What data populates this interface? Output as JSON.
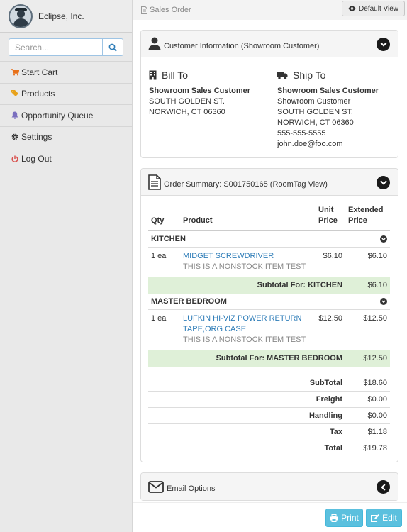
{
  "sidebar": {
    "company": "Eclipse, Inc.",
    "search_placeholder": "Search...",
    "items": [
      {
        "label": "Start Cart",
        "icon": "cart-icon",
        "color": "#e8711a"
      },
      {
        "label": "Products",
        "icon": "tags-icon",
        "color": "#e8a21a"
      },
      {
        "label": "Opportunity Queue",
        "icon": "bell-icon",
        "color": "#7a6fbf"
      },
      {
        "label": "Settings",
        "icon": "gear-icon",
        "color": "#333333"
      },
      {
        "label": "Log Out",
        "icon": "power-icon",
        "color": "#d9534f"
      }
    ]
  },
  "header": {
    "breadcrumb": "Sales Order",
    "default_view_label": "Default View"
  },
  "customer": {
    "title": "Customer Information (Showroom Customer)",
    "bill_to": {
      "heading": "Bill To",
      "name": "Showroom Sales Customer",
      "line1": "SOUTH GOLDEN ST.",
      "line2": "NORWICH, CT 06360"
    },
    "ship_to": {
      "heading": "Ship To",
      "name": "Showroom Sales Customer",
      "line1": "Showroom Customer",
      "line2": "SOUTH GOLDEN ST.",
      "line3": "NORWICH, CT 06360",
      "phone": "555-555-5555",
      "email": "john.doe@foo.com"
    }
  },
  "order": {
    "title": "Order Summary: S001750165 (RoomTag View)",
    "columns": {
      "qty": "Qty",
      "product": "Product",
      "unit_price_1": "Unit",
      "unit_price_2": "Price",
      "ext_price_1": "Extended",
      "ext_price_2": "Price"
    },
    "sections": [
      {
        "name": "KITCHEN",
        "item": {
          "qty": "1 ea",
          "product_line1": "MIDGET SCREWDRIVER",
          "product_line2": "",
          "note": "THIS IS A NONSTOCK ITEM TEST",
          "unit": "$6.10",
          "ext": "$6.10"
        },
        "subtotal_label": "Subtotal For: KITCHEN",
        "subtotal": "$6.10"
      },
      {
        "name": "MASTER BEDROOM",
        "item": {
          "qty": "1 ea",
          "product_line1": "LUFKIN HI-VIZ POWER RETURN",
          "product_line2": "TAPE,ORG CASE",
          "note": "THIS IS A NONSTOCK ITEM TEST",
          "unit": "$12.50",
          "ext": "$12.50"
        },
        "subtotal_label": "Subtotal For: MASTER BEDROOM",
        "subtotal": "$12.50"
      }
    ],
    "totals": [
      {
        "label": "SubTotal",
        "value": "$18.60"
      },
      {
        "label": "Freight",
        "value": "$0.00"
      },
      {
        "label": "Handling",
        "value": "$0.00"
      },
      {
        "label": "Tax",
        "value": "$1.18"
      },
      {
        "label": "Total",
        "value": "$19.78"
      }
    ]
  },
  "email": {
    "title": "Email Options"
  },
  "footer": {
    "print_label": "Print",
    "edit_label": "Edit"
  },
  "colors": {
    "accent": "#5bc0de",
    "link": "#2f7db8",
    "subtotal_bg": "#dff0d8"
  }
}
